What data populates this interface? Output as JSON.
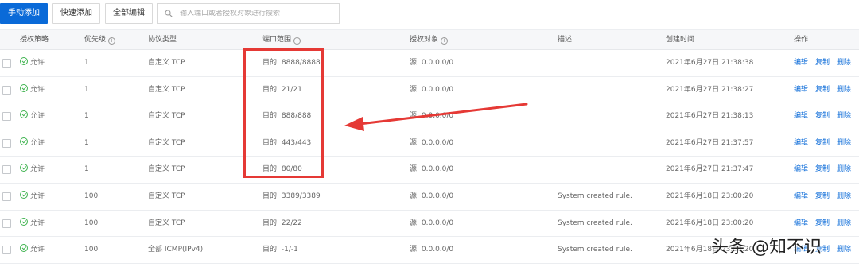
{
  "toolbar": {
    "manual_add": "手动添加",
    "quick_add": "快速添加",
    "edit_all": "全部编辑",
    "search_placeholder": "输入端口或者授权对象进行搜索"
  },
  "columns": {
    "policy": "授权策略",
    "priority": "优先级",
    "protocol": "协议类型",
    "port_range": "端口范围",
    "auth_object": "授权对象",
    "description": "描述",
    "created_at": "创建时间",
    "actions": "操作"
  },
  "actions": {
    "edit": "编辑",
    "copy": "复制",
    "delete": "删除"
  },
  "rows": [
    {
      "policy": "允许",
      "priority": "1",
      "protocol": "自定义 TCP",
      "port": "目的: 8888/8888",
      "auth": "源: 0.0.0.0/0",
      "desc": "",
      "created": "2021年6月27日 21:38:38"
    },
    {
      "policy": "允许",
      "priority": "1",
      "protocol": "自定义 TCP",
      "port": "目的: 21/21",
      "auth": "源: 0.0.0.0/0",
      "desc": "",
      "created": "2021年6月27日 21:38:27"
    },
    {
      "policy": "允许",
      "priority": "1",
      "protocol": "自定义 TCP",
      "port": "目的: 888/888",
      "auth": "源: 0.0.0.0/0",
      "desc": "",
      "created": "2021年6月27日 21:38:13"
    },
    {
      "policy": "允许",
      "priority": "1",
      "protocol": "自定义 TCP",
      "port": "目的: 443/443",
      "auth": "源: 0.0.0.0/0",
      "desc": "",
      "created": "2021年6月27日 21:37:57"
    },
    {
      "policy": "允许",
      "priority": "1",
      "protocol": "自定义 TCP",
      "port": "目的: 80/80",
      "auth": "源: 0.0.0.0/0",
      "desc": "",
      "created": "2021年6月27日 21:37:47"
    },
    {
      "policy": "允许",
      "priority": "100",
      "protocol": "自定义 TCP",
      "port": "目的: 3389/3389",
      "auth": "源: 0.0.0.0/0",
      "desc": "System created rule.",
      "created": "2021年6月18日 23:00:20"
    },
    {
      "policy": "允许",
      "priority": "100",
      "protocol": "自定义 TCP",
      "port": "目的: 22/22",
      "auth": "源: 0.0.0.0/0",
      "desc": "System created rule.",
      "created": "2021年6月18日 23:00:20"
    },
    {
      "policy": "允许",
      "priority": "100",
      "protocol": "全部 ICMP(IPv4)",
      "port": "目的: -1/-1",
      "auth": "源: 0.0.0.0/0",
      "desc": "System created rule.",
      "created": "2021年6月18日 23:00:20"
    }
  ],
  "annotation": {
    "color": "#e53935"
  },
  "watermark": "头条 @知不识",
  "colors": {
    "primary": "#0a6ad8",
    "allow": "#3fb34f",
    "annotation": "#e53935"
  }
}
